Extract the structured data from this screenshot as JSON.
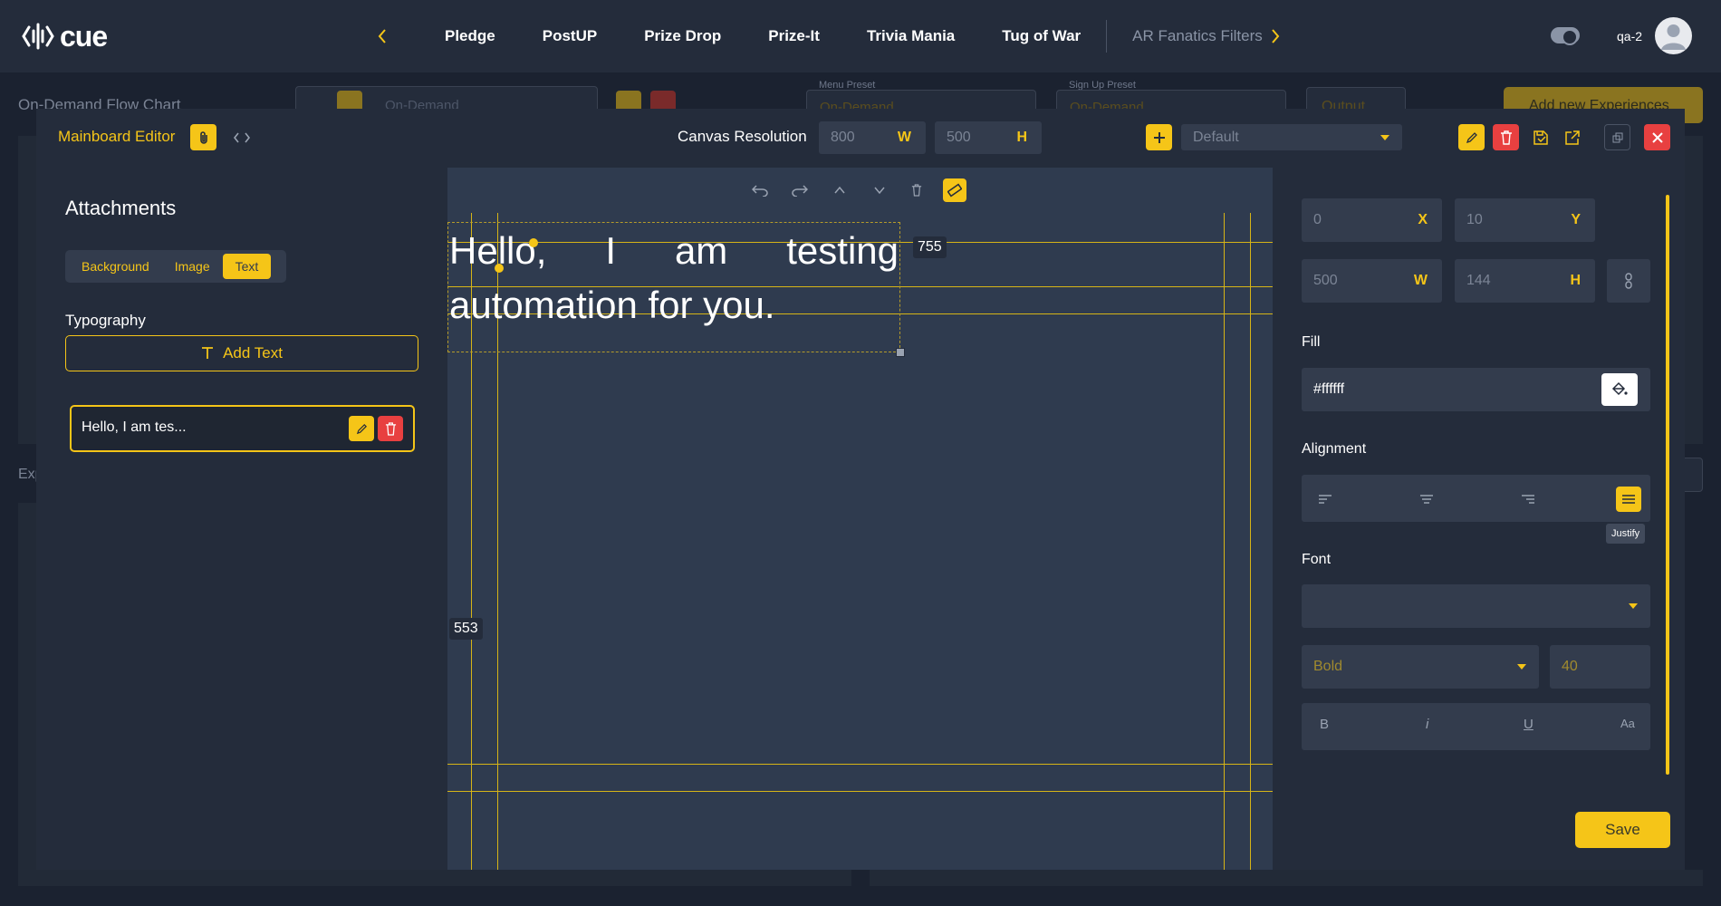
{
  "app": {
    "logo_text": "cue",
    "user_name": "qa-2"
  },
  "nav": {
    "items": [
      "Pledge",
      "PostUP",
      "Prize Drop",
      "Prize-It",
      "Trivia Mania",
      "Tug of War",
      "AR Fanatics Filters"
    ]
  },
  "background_page": {
    "title": "On-Demand Flow Chart",
    "flow_select": "On-Demand",
    "menu_preset_label": "Menu Preset",
    "menu_preset_value": "On-Demand",
    "signup_preset_label": "Sign Up Preset",
    "signup_preset_value": "On-Demand",
    "output_label": "Output",
    "add_button": "Add new Experiences",
    "side_label": "Exp"
  },
  "editor": {
    "title": "Mainboard Editor",
    "canvas_resolution_label": "Canvas Resolution",
    "canvas_width": "800",
    "canvas_height": "500",
    "unit_w": "W",
    "unit_h": "H",
    "unit_x": "X",
    "unit_y": "Y",
    "preset_select": "Default"
  },
  "attachments": {
    "heading": "Attachments",
    "tabs": [
      "Background",
      "Image",
      "Text"
    ],
    "active_tab": "Text",
    "typography_label": "Typography",
    "add_text_label": "Add Text",
    "layers": [
      {
        "label": "Hello, I am tes..."
      }
    ]
  },
  "canvas": {
    "text": "Hello, I am testing automation for you.",
    "measure_right": "755",
    "measure_bottom": "553"
  },
  "properties": {
    "x": "0",
    "y": "10",
    "w": "500",
    "h": "144",
    "fill_label": "Fill",
    "fill_value": "#ffffff",
    "alignment_label": "Alignment",
    "active_alignment": "justify",
    "tooltip": "Justify",
    "font_label": "Font",
    "font_value": "",
    "weight_value": "Bold",
    "size_value": "40",
    "style_buttons": [
      "B",
      "i",
      "U",
      "Aa"
    ],
    "save_label": "Save"
  },
  "colors": {
    "accent": "#f5c518",
    "danger": "#e84040",
    "panel": "#242c3b",
    "canvas": "#2f3b4f"
  }
}
